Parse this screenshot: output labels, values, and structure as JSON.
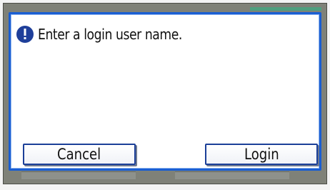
{
  "dialog": {
    "message": "Enter a login user name.",
    "icon": "info-icon"
  },
  "buttons": {
    "cancel_label": "Cancel",
    "login_label": "Login"
  },
  "colors": {
    "dialog_border": "#1a5ed2",
    "button_border": "#1b3f98",
    "icon_fill": "#1f3f9a",
    "background": "#7f8178"
  }
}
